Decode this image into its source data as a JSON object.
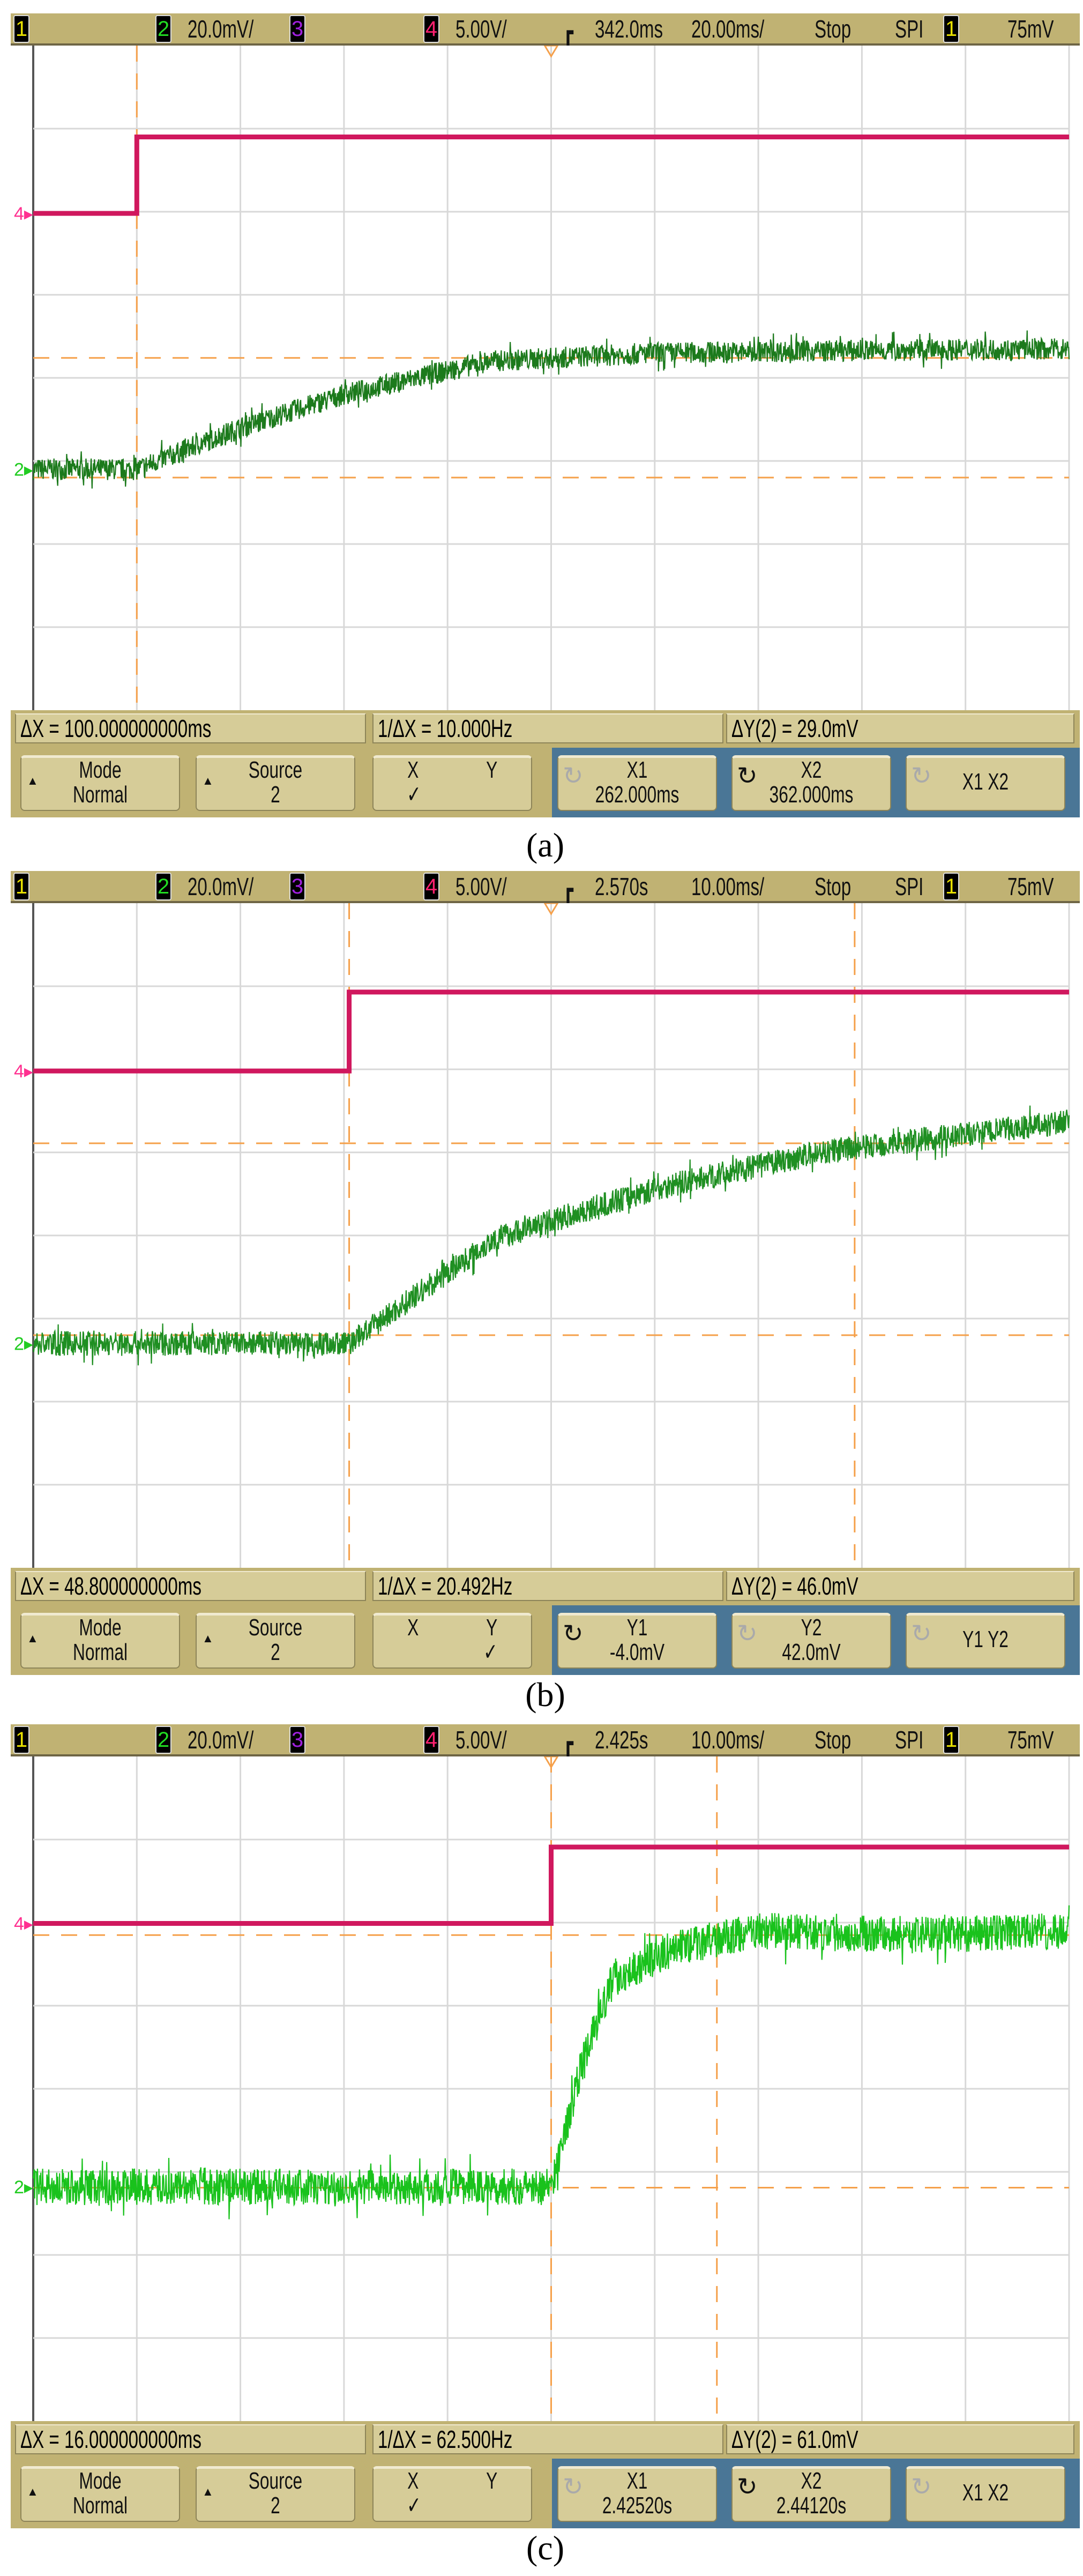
{
  "panels": [
    {
      "caption": "(a)",
      "header": {
        "ch1": "1",
        "ch2": "2",
        "ch2_scale": "20.0mV/",
        "ch3": "3",
        "ch4": "4",
        "ch4_scale": "5.00V/",
        "delay": "342.0ms",
        "timebase": "20.00ms/",
        "run_state": "Stop",
        "trigger_source": "SPI",
        "trig_ch": "1",
        "trigger_level": "75mV"
      },
      "measurements": {
        "dx": "ΔX = 100.000000000ms",
        "inv_dx": "1/ΔX = 10.000Hz",
        "dy": "ΔY(2) = 29.0mV"
      },
      "buttons": {
        "mode_label": "Mode",
        "mode_value": "Normal",
        "source_label": "Source",
        "source_value": "2",
        "x_label": "X",
        "y_label": "Y",
        "check": "✓",
        "c1_label": "X1",
        "c1_value": "262.000ms",
        "c2_label": "X2",
        "c2_value": "362.000ms",
        "c12_label": "X1 X2",
        "active_knob": 2,
        "check_side": "x"
      }
    },
    {
      "caption": "(b)",
      "header": {
        "ch1": "1",
        "ch2": "2",
        "ch2_scale": "20.0mV/",
        "ch3": "3",
        "ch4": "4",
        "ch4_scale": "5.00V/",
        "delay": "2.570s",
        "timebase": "10.00ms/",
        "run_state": "Stop",
        "trigger_source": "SPI",
        "trig_ch": "1",
        "trigger_level": "75mV"
      },
      "measurements": {
        "dx": "ΔX = 48.800000000ms",
        "inv_dx": "1/ΔX = 20.492Hz",
        "dy": "ΔY(2) = 46.0mV"
      },
      "buttons": {
        "mode_label": "Mode",
        "mode_value": "Normal",
        "source_label": "Source",
        "source_value": "2",
        "x_label": "X",
        "y_label": "Y",
        "check": "✓",
        "c1_label": "Y1",
        "c1_value": "-4.0mV",
        "c2_label": "Y2",
        "c2_value": "42.0mV",
        "c12_label": "Y1 Y2",
        "active_knob": 1,
        "check_side": "y"
      }
    },
    {
      "caption": "(c)",
      "header": {
        "ch1": "1",
        "ch2": "2",
        "ch2_scale": "20.0mV/",
        "ch3": "3",
        "ch4": "4",
        "ch4_scale": "5.00V/",
        "delay": "2.425s",
        "timebase": "10.00ms/",
        "run_state": "Stop",
        "trigger_source": "SPI",
        "trig_ch": "1",
        "trigger_level": "75mV"
      },
      "measurements": {
        "dx": "ΔX = 16.000000000ms",
        "inv_dx": "1/ΔX = 62.500Hz",
        "dy": "ΔY(2) = 61.0mV"
      },
      "buttons": {
        "mode_label": "Mode",
        "mode_value": "Normal",
        "source_label": "Source",
        "source_value": "2",
        "x_label": "X",
        "y_label": "Y",
        "check": "✓",
        "c1_label": "X1",
        "c1_value": "2.42520s",
        "c2_label": "X2",
        "c2_value": "2.44120s",
        "c12_label": "X1 X2",
        "active_knob": 2,
        "check_side": "x"
      }
    }
  ],
  "colors": {
    "ch2_a": "#1c7a1c",
    "ch2_b": "#1f8f22",
    "ch2_c": "#19c21c",
    "ch4": "#d0185e",
    "cursor": "#f5a04a",
    "grid": "#d8d8d8",
    "bezel": "#c0b273",
    "blue": "#4a7696"
  },
  "chart_data": [
    {
      "type": "line",
      "title": "(a)",
      "x_unit": "div",
      "y_unit": "div (up from center)",
      "xlim": [
        0,
        10
      ],
      "ylim": [
        -4,
        4
      ],
      "grid": true,
      "series": [
        {
          "name": "Ch4 5.00V/div",
          "x": [
            0,
            1,
            1,
            10
          ],
          "y": [
            1.98,
            1.98,
            2.9,
            2.9
          ]
        },
        {
          "name": "Ch2 20.0mV/div",
          "x": [
            0,
            1,
            2,
            3,
            4.4,
            6,
            8,
            10
          ],
          "y": [
            -1.1,
            -1.1,
            -0.6,
            -0.2,
            0.2,
            0.3,
            0.33,
            0.35
          ],
          "noise": 0.13
        }
      ],
      "cursors": {
        "vertical": [
          1
        ],
        "horizontal": [
          0.24,
          -1.2
        ]
      }
    },
    {
      "type": "line",
      "title": "(b)",
      "x_unit": "div",
      "y_unit": "div (up from center)",
      "xlim": [
        0,
        10
      ],
      "ylim": [
        -4,
        4
      ],
      "grid": true,
      "series": [
        {
          "name": "Ch4 5.00V/div",
          "x": [
            0,
            3.05,
            3.05,
            10
          ],
          "y": [
            1.98,
            1.98,
            2.93,
            2.93
          ]
        },
        {
          "name": "Ch2 20.0mV/div",
          "x": [
            0,
            3.05,
            4.45,
            6.03,
            7.6,
            10
          ],
          "y": [
            -1.3,
            -1.3,
            -0.04,
            0.57,
            1.0,
            1.37
          ],
          "noise": 0.15
        }
      ],
      "cursors": {
        "vertical": [
          3.05,
          7.93
        ],
        "horizontal": [
          1.11,
          -1.2
        ]
      }
    },
    {
      "type": "line",
      "title": "(c)",
      "x_unit": "div",
      "y_unit": "div (up from center)",
      "xlim": [
        0,
        10
      ],
      "ylim": [
        -4,
        4
      ],
      "grid": true,
      "series": [
        {
          "name": "Ch4 5.00V/div",
          "x": [
            0,
            5,
            5,
            10
          ],
          "y": [
            1.99,
            1.99,
            2.91,
            2.91
          ]
        },
        {
          "name": "Ch2 20.0mV/div",
          "x": [
            0,
            5,
            5.3,
            5.6,
            6.2,
            7,
            8.5,
            10
          ],
          "y": [
            -1.18,
            -1.18,
            0.3,
            1.32,
            1.7,
            1.9,
            1.85,
            1.9
          ],
          "noise": 0.22
        }
      ],
      "cursors": {
        "vertical": [
          5,
          6.6
        ],
        "horizontal": [
          1.85,
          -1.19
        ]
      }
    }
  ]
}
